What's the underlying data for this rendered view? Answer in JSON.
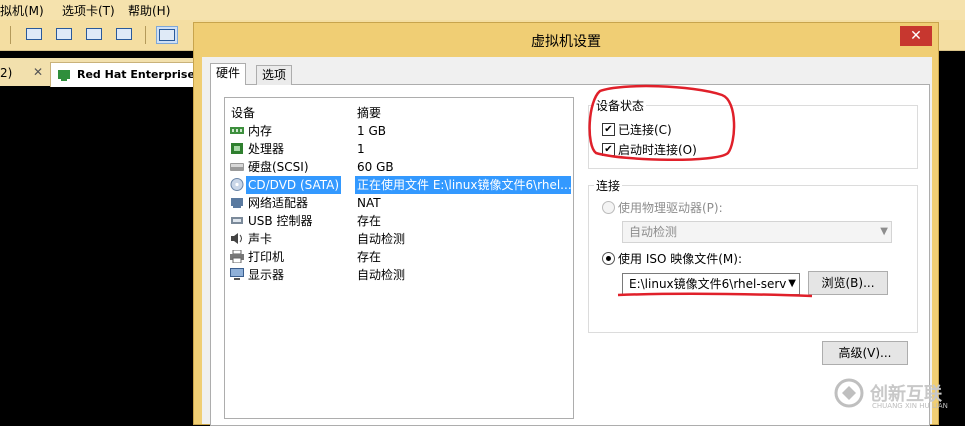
{
  "menubar": {
    "items": [
      "拟机(M)",
      "选项卡(T)",
      "帮助(H)"
    ]
  },
  "tabs": {
    "left_fragment": "2)",
    "vm_tab_label": "Red Hat Enterprise L",
    "close": "✕"
  },
  "dialog": {
    "title": "虚拟机设置",
    "close": "✕",
    "tabs": [
      "硬件",
      "选项"
    ],
    "device_list": {
      "headers": {
        "device": "设备",
        "summary": "摘要"
      },
      "rows": [
        {
          "name": "内存",
          "summary": "1 GB",
          "icon": "memory-icon"
        },
        {
          "name": "处理器",
          "summary": "1",
          "icon": "processor-icon"
        },
        {
          "name": "硬盘(SCSI)",
          "summary": "60 GB",
          "icon": "hard-disk-icon"
        },
        {
          "name": "CD/DVD (SATA)",
          "summary": "正在使用文件 E:\\linux镜像文件6\\rhel...",
          "icon": "cd-dvd-icon"
        },
        {
          "name": "网络适配器",
          "summary": "NAT",
          "icon": "network-adapter-icon"
        },
        {
          "name": "USB 控制器",
          "summary": "存在",
          "icon": "usb-icon"
        },
        {
          "name": "声卡",
          "summary": "自动检测",
          "icon": "sound-icon"
        },
        {
          "name": "打印机",
          "summary": "存在",
          "icon": "printer-icon"
        },
        {
          "name": "显示器",
          "summary": "自动检测",
          "icon": "display-icon"
        }
      ]
    },
    "device_status": {
      "title": "设备状态",
      "connected": "已连接(C)",
      "connect_at_power_on": "启动时连接(O)"
    },
    "connection": {
      "title": "连接",
      "physical_drive": "使用物理驱动器(P):",
      "physical_drive_value": "自动检测",
      "iso_image": "使用 ISO 映像文件(M):",
      "iso_path": "E:\\linux镜像文件6\\rhel-serve",
      "browse": "浏览(B)...",
      "advanced": "高级(V)..."
    }
  },
  "watermark": {
    "text": "创新互联",
    "subtext": "CHUANG XIN HU LIAN"
  },
  "colors": {
    "annotation": "#e0202a",
    "selection": "#3399ff",
    "title_bar": "#f0ce74"
  }
}
